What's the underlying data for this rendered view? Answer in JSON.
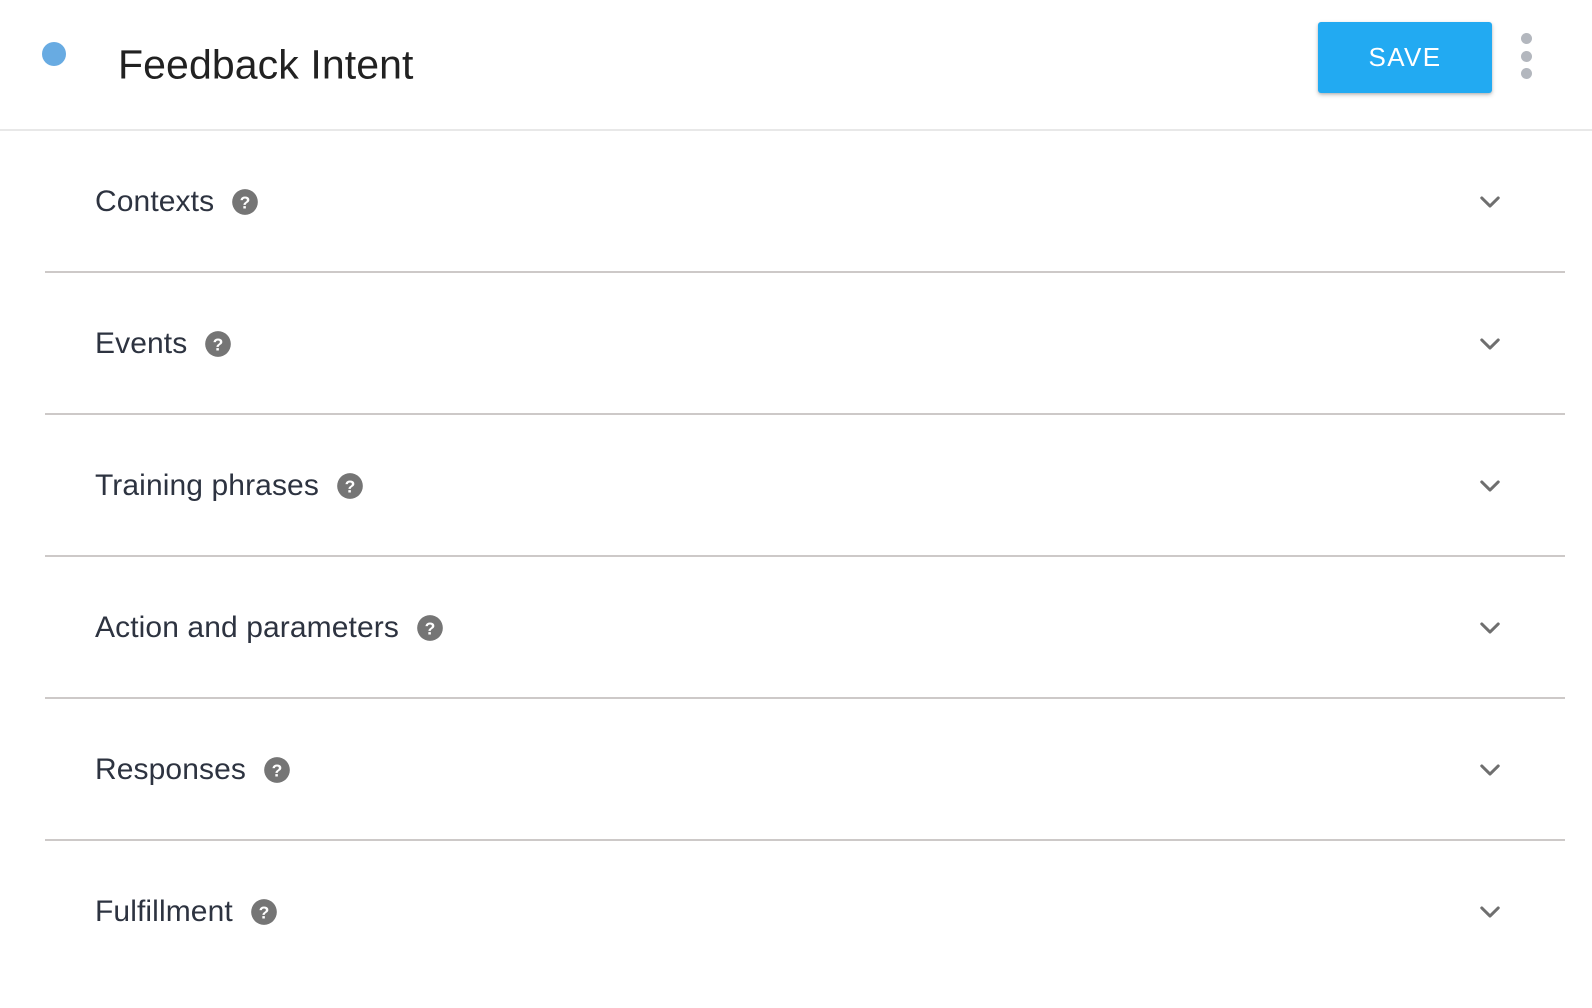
{
  "header": {
    "status_dot_color": "#68abe2",
    "title": "Feedback Intent",
    "save_label": "SAVE",
    "save_color": "#22aaf2",
    "menu_icon": "more-vert-icon"
  },
  "sections": [
    {
      "label": "Contexts",
      "help_icon": "help-circle-icon",
      "chevron_icon": "chevron-down-icon",
      "expanded": false
    },
    {
      "label": "Events",
      "help_icon": "help-circle-icon",
      "chevron_icon": "chevron-down-icon",
      "expanded": false
    },
    {
      "label": "Training phrases",
      "help_icon": "help-circle-icon",
      "chevron_icon": "chevron-down-icon",
      "expanded": false
    },
    {
      "label": "Action and parameters",
      "help_icon": "help-circle-icon",
      "chevron_icon": "chevron-down-icon",
      "expanded": false
    },
    {
      "label": "Responses",
      "help_icon": "help-circle-icon",
      "chevron_icon": "chevron-down-icon",
      "expanded": false
    },
    {
      "label": "Fulfillment",
      "help_icon": "help-circle-icon",
      "chevron_icon": "chevron-down-icon",
      "expanded": false
    }
  ],
  "colors": {
    "accent": "#22aaf2",
    "label_text": "#2d3340",
    "title_text": "#212121",
    "divider": "#cdc9c8",
    "header_divider": "#e8e8e8",
    "icon_gray": "#757575",
    "kebab_gray": "#b3b7be"
  }
}
